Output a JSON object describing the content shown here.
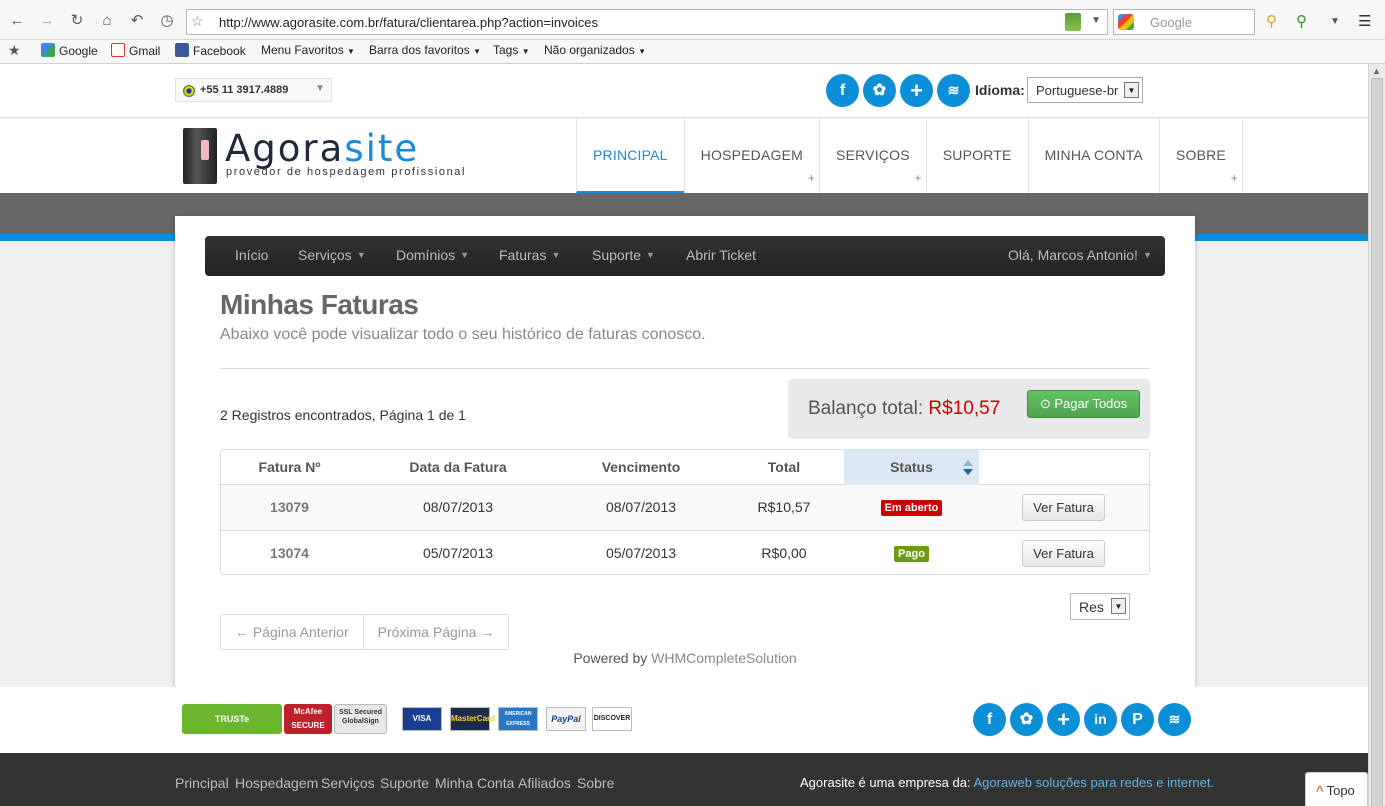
{
  "browser": {
    "url": "http://www.agorasite.com.br/fatura/clientarea.php?action=invoices",
    "search_placeholder": "Google",
    "bookmarks": [
      {
        "label": "Google"
      },
      {
        "label": "Gmail"
      },
      {
        "label": "Facebook"
      },
      {
        "label": "Menu Favoritos"
      },
      {
        "label": "Barra dos favoritos"
      },
      {
        "label": "Tags"
      },
      {
        "label": "Não organizados"
      }
    ]
  },
  "topbar": {
    "phone": "+55 11 3917.4889",
    "idioma_label": "Idioma:",
    "idioma_value": "Portuguese-br"
  },
  "logo": {
    "name_main": "Agora",
    "name_accent": "site",
    "tagline": "provedor de hospedagem profissional"
  },
  "mainnav": [
    {
      "label": "PRINCIPAL"
    },
    {
      "label": "HOSPEDAGEM"
    },
    {
      "label": "SERVIÇOS"
    },
    {
      "label": "SUPORTE"
    },
    {
      "label": "MINHA CONTA"
    },
    {
      "label": "SOBRE"
    }
  ],
  "clientnav": {
    "items": [
      "Início",
      "Serviços",
      "Domínios",
      "Faturas",
      "Suporte",
      "Abrir Ticket"
    ],
    "user": "Olá, Marcos Antonio!"
  },
  "page": {
    "title": "Minhas Faturas",
    "subtitle": "Abaixo você pode visualizar todo o seu histórico de faturas conosco.",
    "records": "2 Registros encontrados, Página 1 de 1",
    "balance_label": "Balanço total:",
    "balance_value": "R$10,57",
    "pay_all": "Pagar Todos"
  },
  "table": {
    "headers": [
      "Fatura Nº",
      "Data da Fatura",
      "Vencimento",
      "Total",
      "Status"
    ],
    "rows": [
      {
        "number": "13079",
        "date": "08/07/2013",
        "due": "08/07/2013",
        "total": "R$10,57",
        "status": "Em aberto",
        "action": "Ver Fatura"
      },
      {
        "number": "13074",
        "date": "05/07/2013",
        "due": "05/07/2013",
        "total": "R$0,00",
        "status": "Pago",
        "action": "Ver Fatura"
      }
    ]
  },
  "pagination": {
    "prev": "← Página Anterior",
    "next": "Próxima Página →",
    "per_page": "Res"
  },
  "powered": {
    "prefix": "Powered by",
    "link": "WHMCompleteSolution"
  },
  "footer": {
    "trust_logos": [
      "TRUSTe",
      "McAfee SECURE",
      "SSL Secured GlobalSign"
    ],
    "card_logos": [
      "VISA",
      "MasterCard",
      "AMERICAN EXPRESS",
      "PayPal",
      "DISCOVER"
    ],
    "links": [
      "Principal",
      "Hospedagem",
      "Serviços",
      "Suporte",
      "Minha Conta",
      "Afiliados",
      "Sobre"
    ],
    "company_text": "Agorasite é uma empresa da:",
    "company_link": "Agoraweb soluções para redes e internet.",
    "top_button": "Topo"
  },
  "colors": {
    "brand_blue": "#0c8fd6",
    "balance_red": "#cc0000",
    "pay_green": "#51a351",
    "status_open": "#cc0000",
    "status_paid": "#6f9a16"
  },
  "icons": [
    "back-icon",
    "forward-icon",
    "reload-icon",
    "home-icon",
    "undo-icon",
    "history-icon",
    "bookmark-star-icon",
    "rss-icon",
    "key-icon",
    "menu-icon",
    "facebook-icon",
    "twitter-icon",
    "plus-icon",
    "linkedin-icon",
    "pinterest-icon",
    "sort-icon",
    "check-circle-icon"
  ]
}
